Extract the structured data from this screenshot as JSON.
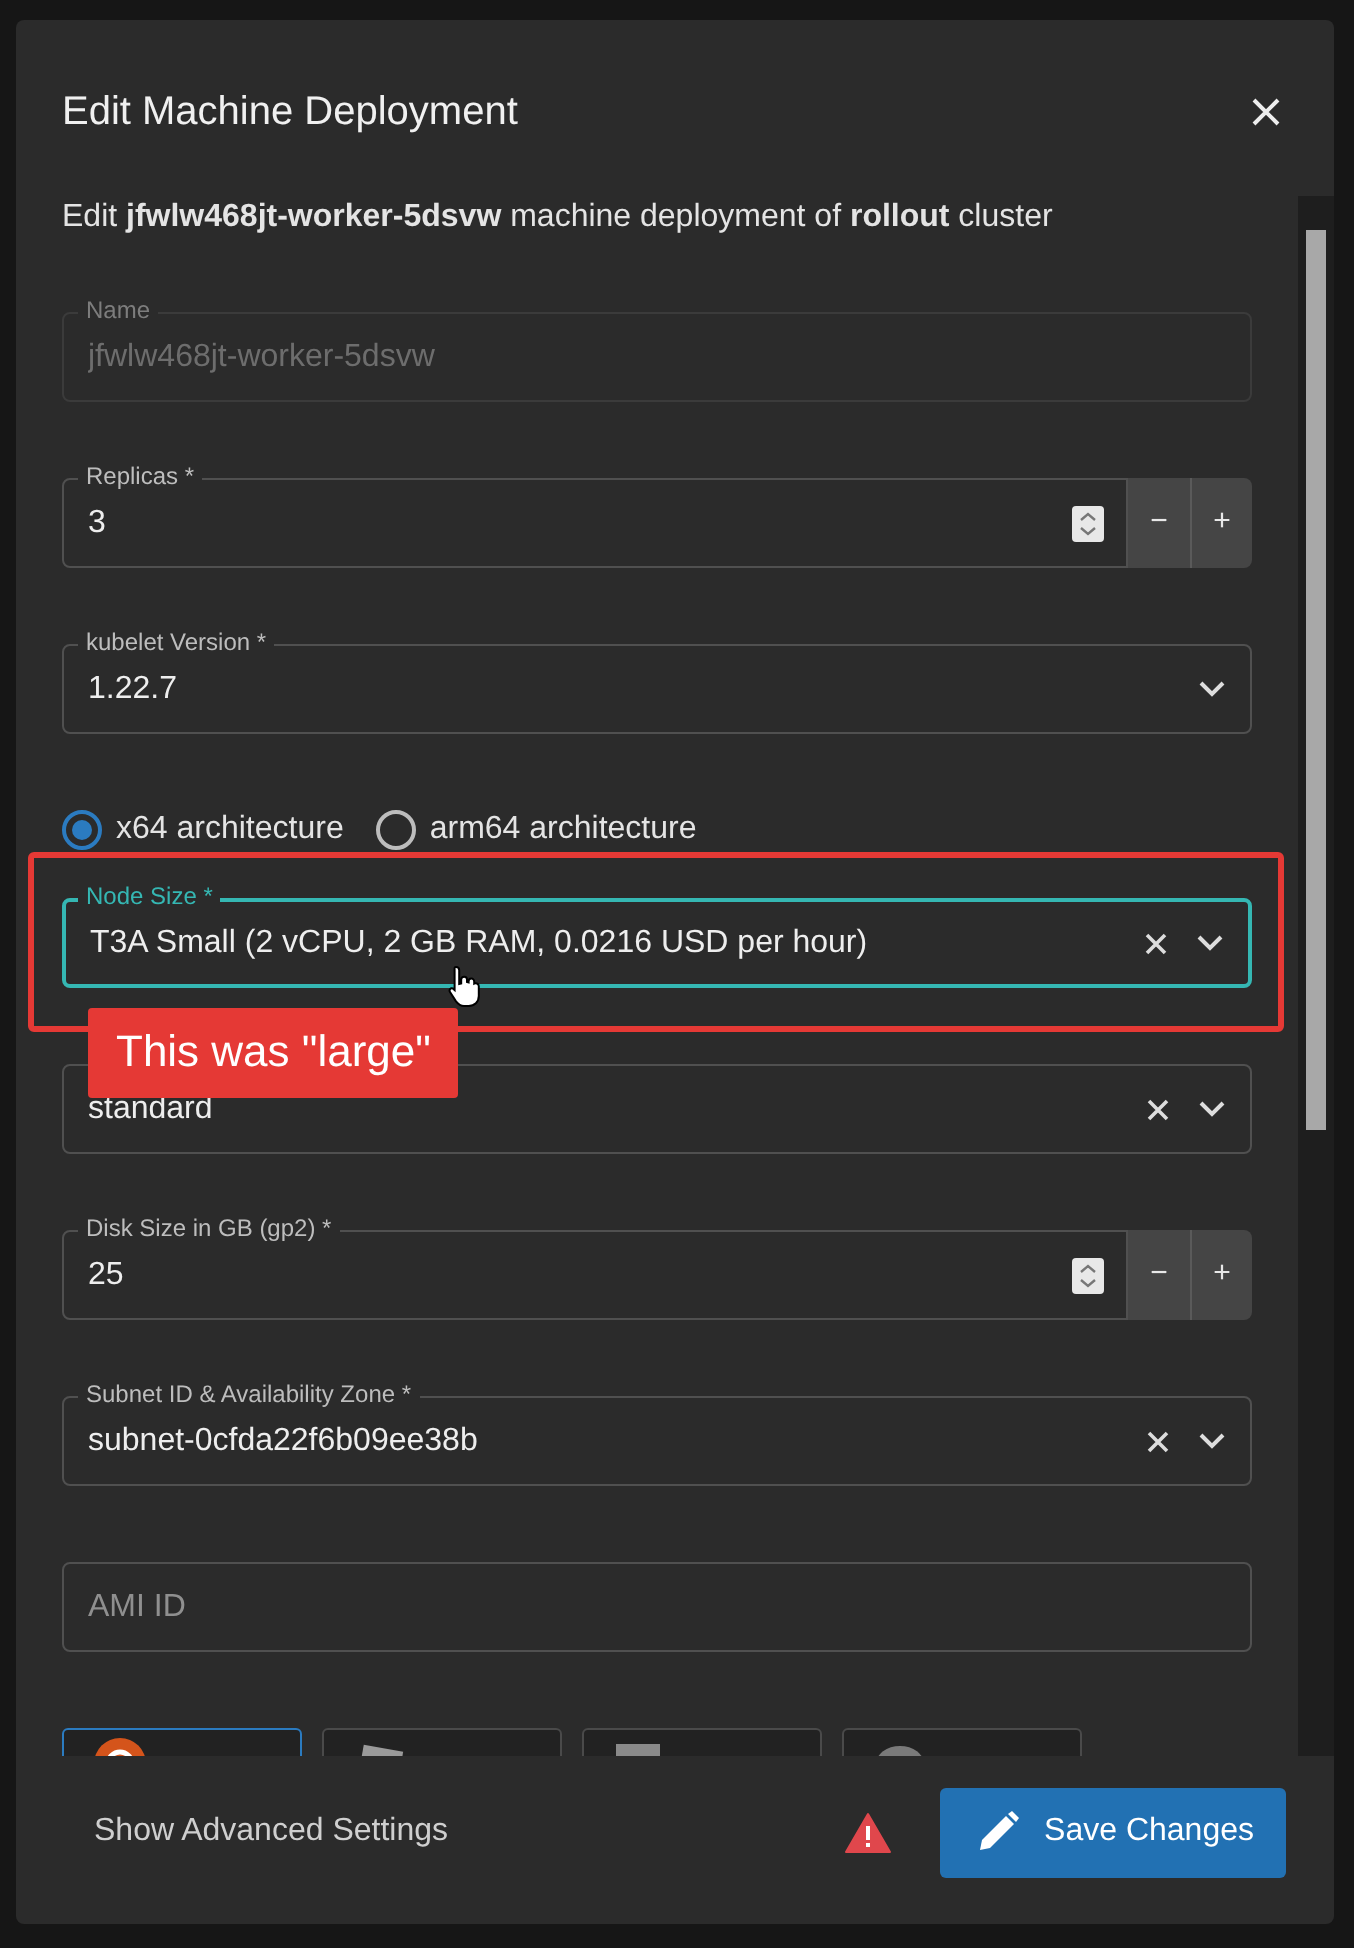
{
  "modal": {
    "title": "Edit Machine Deployment",
    "description": "Edit **jfwlw468jt-worker-5dsvw** machine deployment of **rollout** cluster"
  },
  "fields": [
    {
      "kind": "text",
      "label": "Name",
      "value": "jfwlw468jt-worker-5dsvw",
      "disabled": true
    },
    {
      "kind": "number",
      "label": "Replicas *",
      "value": "3",
      "decrement": "−",
      "increment": "+"
    },
    {
      "kind": "select",
      "label": "kubelet Version *",
      "value": "1.22.7",
      "clearable": false,
      "focused": false,
      "highlighted": false
    },
    {
      "kind": "radios",
      "options": [
        {
          "label": "x64 architecture",
          "selected": true
        },
        {
          "label": "arm64 architecture",
          "selected": false
        }
      ]
    },
    {
      "kind": "select",
      "label": "Node Size *",
      "value": "T3A Small (2 vCPU, 2 GB RAM, 0.0216 USD per hour)",
      "clearable": true,
      "focused": true,
      "highlighted": true,
      "callout": "This was \"large\""
    },
    {
      "kind": "select",
      "value": "standard",
      "clearable": true,
      "focused": false,
      "highlighted": false
    },
    {
      "kind": "number",
      "label": "Disk Size in GB (gp2) *",
      "value": "25",
      "decrement": "−",
      "increment": "+"
    },
    {
      "kind": "select",
      "label": "Subnet ID & Availability Zone *",
      "value": "subnet-0cfda22f6b09ee38b",
      "clearable": true,
      "focused": false,
      "highlighted": false
    },
    {
      "kind": "text",
      "placeholder": "AMI ID",
      "disabled": false
    },
    {
      "kind": "os",
      "options": [
        {
          "selected": true
        },
        {
          "selected": false
        },
        {
          "selected": false
        },
        {
          "selected": false
        }
      ]
    }
  ],
  "footer": {
    "link": "Show Advanced Settings",
    "warning": true,
    "save_button": "Save Changes"
  }
}
